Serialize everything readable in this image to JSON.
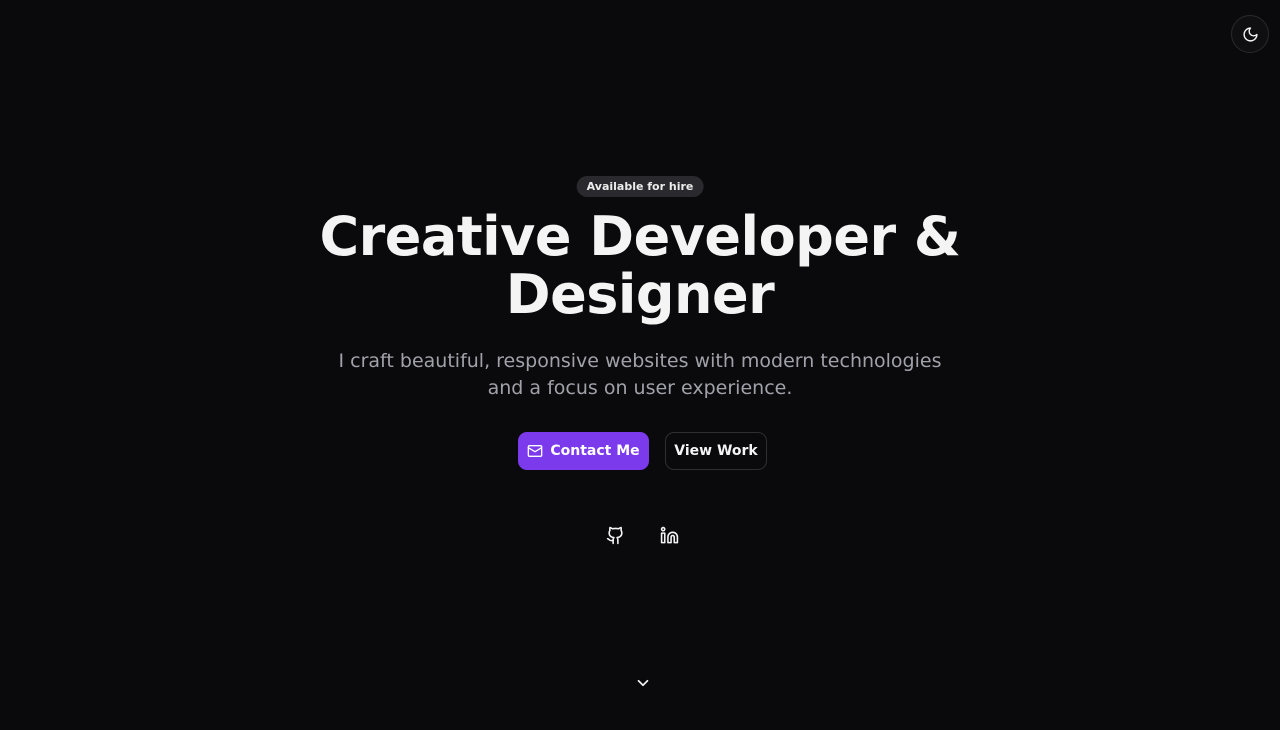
{
  "header": {
    "theme_toggle": {
      "icon": "moon-icon"
    }
  },
  "hero": {
    "badge": "Available for hire",
    "headline": [
      "Creative Developer &",
      "Designer"
    ],
    "subtitle": [
      "I craft beautiful, responsive websites with modern technologies",
      "and a focus on user experience."
    ],
    "buttons": {
      "contact": {
        "label": "Contact Me",
        "icon": "mail-icon"
      },
      "work": {
        "label": "View Work"
      }
    },
    "socials": [
      {
        "icon": "github-icon"
      },
      {
        "icon": "linkedin-icon"
      }
    ],
    "scroll_icon": "chevron-down-icon"
  },
  "colors": {
    "background": "#0a0a0c",
    "accent": "#7c3aed",
    "text": "#f4f4f5",
    "muted": "#a1a1aa",
    "badge_bg": "#2a2a2e"
  }
}
